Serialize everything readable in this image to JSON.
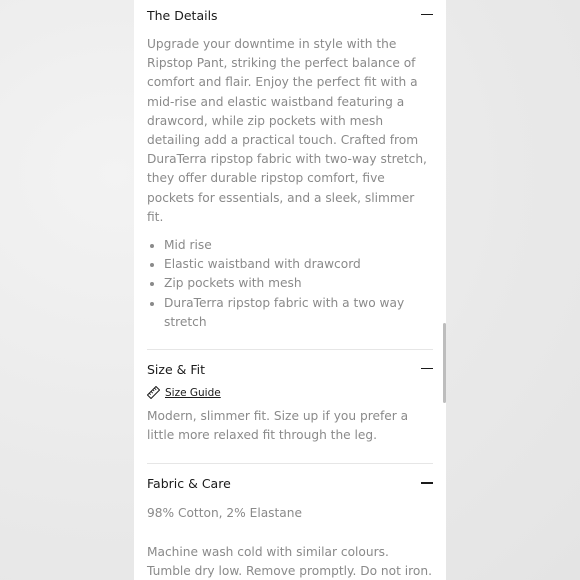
{
  "details": {
    "title": "The Details",
    "toggle_icon": "minus-icon",
    "description": "Upgrade your downtime in style with the Ripstop Pant, striking the perfect balance of comfort and flair. Enjoy the perfect fit with a mid-rise and elastic waistband featuring a drawcord, while zip pockets with mesh detailing add a practical touch. Crafted from DuraTerra ripstop fabric with two-way stretch, they offer durable ripstop comfort, five pockets for essentials, and a sleek, slimmer fit.",
    "bullets": [
      "Mid rise",
      "Elastic waistband with drawcord",
      "Zip pockets with mesh",
      "DuraTerra ripstop fabric with a two way stretch"
    ]
  },
  "size_fit": {
    "title": "Size & Fit",
    "toggle_icon": "minus-icon",
    "guide_icon": "ruler-icon",
    "guide_label": "Size Guide",
    "description": "Modern, slimmer fit. Size up if you prefer a little more relaxed fit through the leg."
  },
  "fabric_care": {
    "title": "Fabric & Care",
    "toggle_icon": "minus-icon",
    "composition": "98% Cotton, 2% Elastane",
    "care": "Machine wash cold with similar colours. Tumble dry low. Remove promptly. Do not iron. Do not bleach."
  },
  "colors": {
    "text_primary": "#1a1a1a",
    "text_secondary": "#8a8a8a",
    "divider": "#e6e6e6",
    "panel": "#ffffff"
  }
}
